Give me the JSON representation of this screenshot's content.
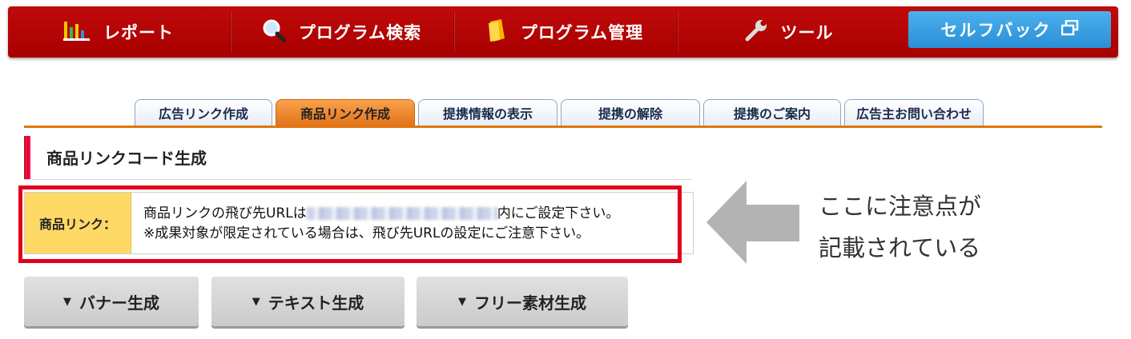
{
  "nav": {
    "report": "レポート",
    "program_search": "プログラム検索",
    "program_manage": "プログラム管理",
    "tools": "ツール",
    "selfback": "セルフバック"
  },
  "tabs": [
    {
      "label": "広告リンク作成",
      "active": false
    },
    {
      "label": "商品リンク作成",
      "active": true
    },
    {
      "label": "提携情報の表示",
      "active": false
    },
    {
      "label": "提携の解除",
      "active": false
    },
    {
      "label": "提携のご案内",
      "active": false
    },
    {
      "label": "広告主お問い合わせ",
      "active": false
    }
  ],
  "section": {
    "title": "商品リンクコード生成"
  },
  "notice": {
    "label": "商品リンク：",
    "line1_pre": "商品リンクの飛び先URLは",
    "line1_post": "内にご設定下さい。",
    "line2": "※成果対象が限定されている場合は、飛び先URLの設定にご注意下さい。"
  },
  "annotation": {
    "line1": "ここに注意点が",
    "line2": "記載されている"
  },
  "buttons": {
    "banner": "バナー生成",
    "text": "テキスト生成",
    "free": "フリー素材生成"
  },
  "colors": {
    "nav_red": "#b00000",
    "selfback_blue": "#3aa0e4",
    "active_tab_orange": "#ef8a2e",
    "notice_label_yellow": "#ffd966",
    "highlight_red": "#e0001a"
  }
}
